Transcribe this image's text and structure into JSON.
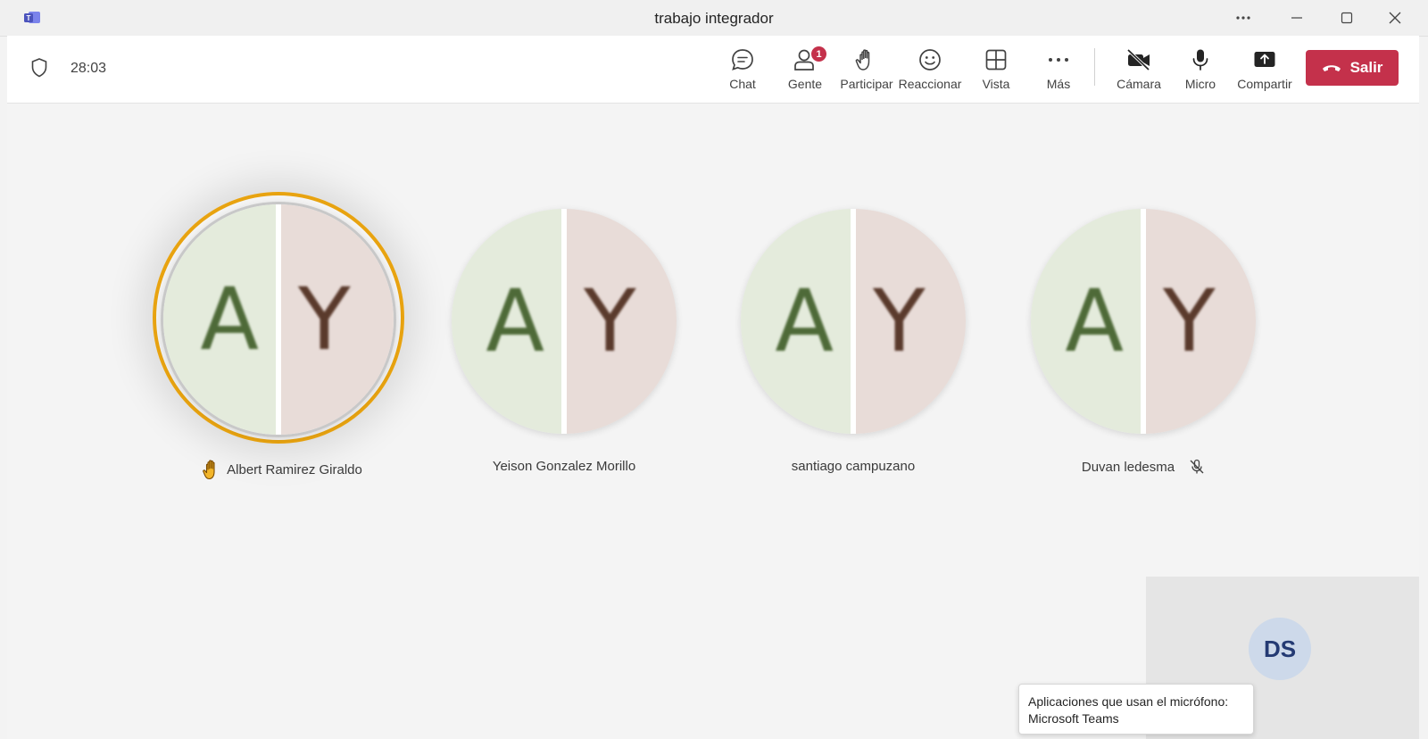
{
  "window": {
    "title": "trabajo integrador"
  },
  "toolbar": {
    "timer": "28:03",
    "buttons": {
      "chat": "Chat",
      "people": "Gente",
      "people_badge": "1",
      "raise_hand": "Participar",
      "react": "Reaccionar",
      "view": "Vista",
      "more": "Más",
      "camera": "Cámara",
      "mic": "Micro",
      "share": "Compartir",
      "leave": "Salir"
    }
  },
  "participants": [
    {
      "name": "Albert Ramirez Giraldo",
      "initial_left": "A",
      "initial_right": "Y",
      "hand_raised": true,
      "speaking": true,
      "muted": false
    },
    {
      "name": "Yeison Gonzalez Morillo",
      "initial_left": "A",
      "initial_right": "Y",
      "hand_raised": false,
      "speaking": false,
      "muted": false
    },
    {
      "name": "santiago campuzano",
      "initial_left": "A",
      "initial_right": "Y",
      "hand_raised": false,
      "speaking": false,
      "muted": false
    },
    {
      "name": "Duvan ledesma",
      "initial_left": "A",
      "initial_right": "Y",
      "hand_raised": false,
      "speaking": false,
      "muted": true
    }
  ],
  "self_view": {
    "initials": "DS"
  },
  "tooltip": {
    "line1": "Aplicaciones que usan el micrófono:",
    "line2": "Microsoft Teams"
  },
  "colors": {
    "leave": "#c4314b",
    "speaking_ring": "#e8a310",
    "badge": "#c4314b"
  }
}
